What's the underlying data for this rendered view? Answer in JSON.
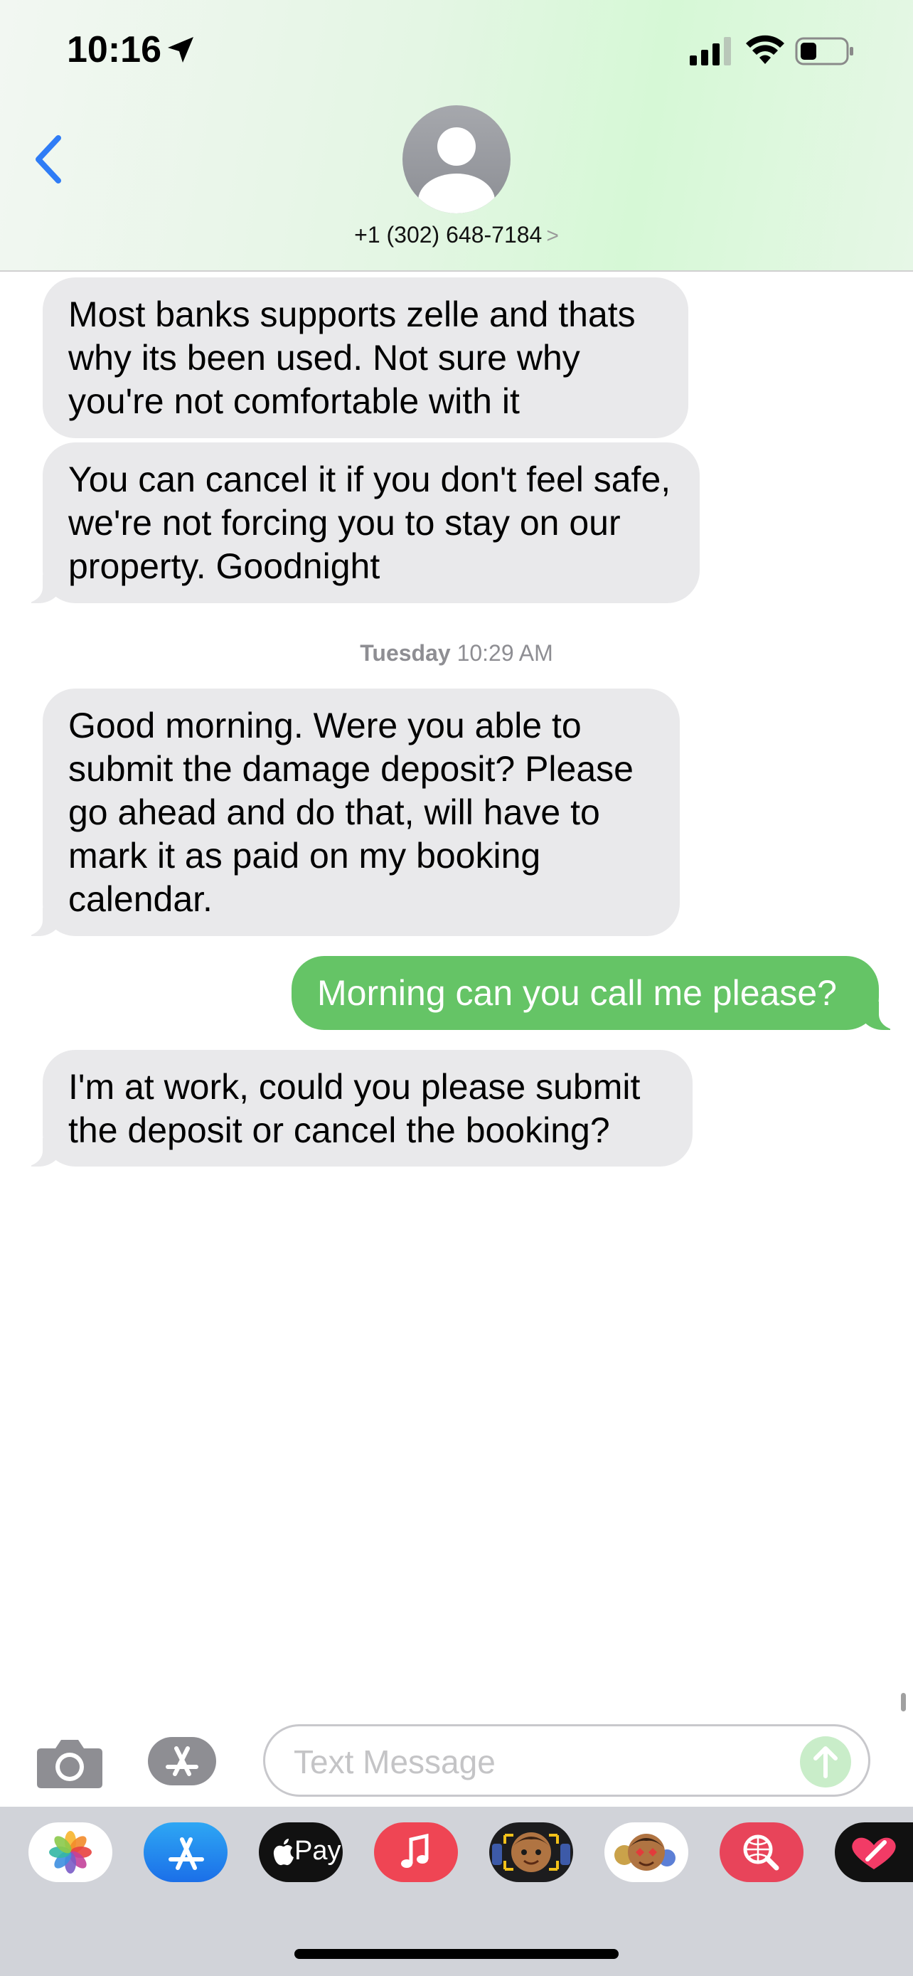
{
  "status_bar": {
    "time": "10:16"
  },
  "contact": {
    "name": "+1 (302) 648-7184",
    "chevron": ">"
  },
  "conversation": {
    "messages_before": [
      {
        "sender": "them",
        "text": "Most banks supports zelle and thats why its been used. Not sure why you're not comfortable with it"
      },
      {
        "sender": "them",
        "text": "You can cancel it if you don't feel safe, we're not forcing you to stay on our property. Goodnight"
      }
    ],
    "timestamp": {
      "day": "Tuesday",
      "time": "10:29 AM"
    },
    "messages_after": [
      {
        "sender": "them",
        "text": "Good morning. Were you able to submit the damage deposit? Please go ahead and do that, will have to mark it as paid on my booking calendar."
      },
      {
        "sender": "me",
        "text": "Morning can you call me please?"
      },
      {
        "sender": "them",
        "text": "I'm at work, could you please submit the deposit or cancel the booking?"
      }
    ]
  },
  "input_bar": {
    "placeholder": "Text Message",
    "value": ""
  },
  "app_drawer": {
    "items": [
      {
        "icon": "photos-icon"
      },
      {
        "icon": "app-store-icon"
      },
      {
        "icon": "apple-pay-icon",
        "label": "Pay"
      },
      {
        "icon": "music-icon"
      },
      {
        "icon": "memoji-icon"
      },
      {
        "icon": "memoji-stickers-icon"
      },
      {
        "icon": "images-search-icon"
      },
      {
        "icon": "digital-touch-icon"
      }
    ]
  },
  "colors": {
    "incoming_bubble": "#e9e9eb",
    "outgoing_bubble": "#65c466",
    "accent_blue": "#2f7cf6",
    "timestamp_gray": "#8e8e93"
  }
}
